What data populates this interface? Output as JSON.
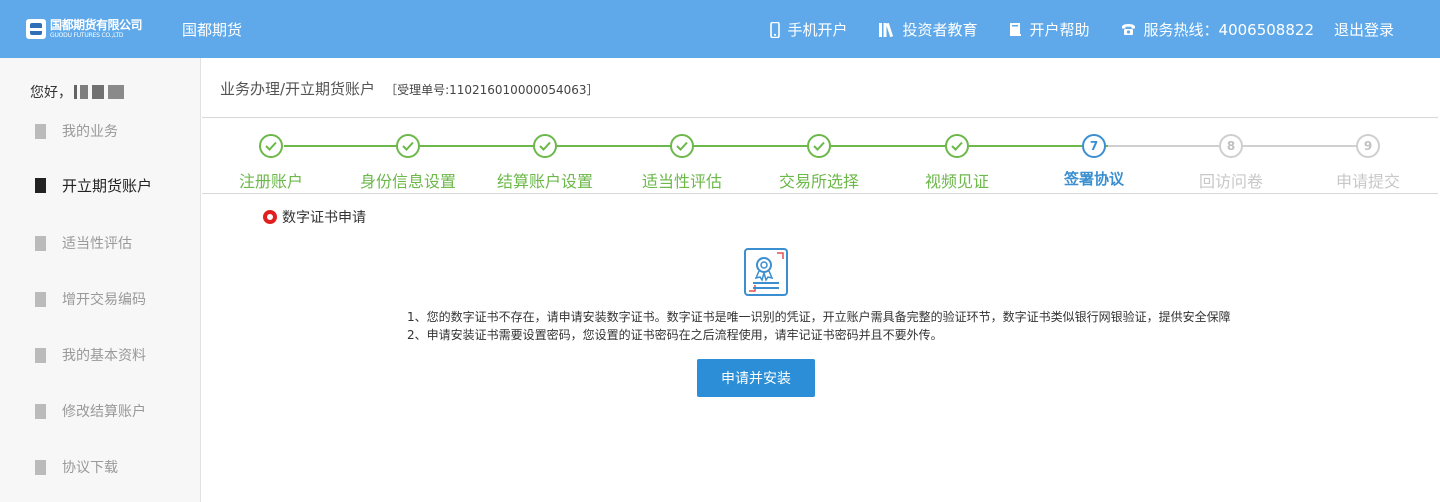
{
  "header": {
    "logo_cn": "国都期货有限公司",
    "logo_en": "GUODU FUTURES CO.,LTD",
    "brand": "国都期货",
    "nav": [
      {
        "label": "手机开户",
        "icon": "mobile-icon"
      },
      {
        "label": "投资者教育",
        "icon": "books-icon"
      },
      {
        "label": "开户帮助",
        "icon": "help-book-icon"
      },
      {
        "label": "服务热线：4006508822",
        "icon": "phone-icon"
      }
    ],
    "logout": "退出登录"
  },
  "sidebar": {
    "greeting": "您好，",
    "items": [
      {
        "label": "我的业务",
        "active": false
      },
      {
        "label": "开立期货账户",
        "active": true
      },
      {
        "label": "适当性评估",
        "active": false
      },
      {
        "label": "增开交易编码",
        "active": false
      },
      {
        "label": "我的基本资料",
        "active": false
      },
      {
        "label": "修改结算账户",
        "active": false
      },
      {
        "label": "协议下载",
        "active": false
      }
    ]
  },
  "breadcrumb": {
    "path": "业务办理/开立期货账户",
    "ticket": "［受理单号:110216010000054063］"
  },
  "steps": [
    {
      "label": "注册账户",
      "status": "done"
    },
    {
      "label": "身份信息设置",
      "status": "done"
    },
    {
      "label": "结算账户设置",
      "status": "done"
    },
    {
      "label": "适当性评估",
      "status": "done"
    },
    {
      "label": "交易所选择",
      "status": "done"
    },
    {
      "label": "视频见证",
      "status": "done"
    },
    {
      "label": "签署协议",
      "status": "current",
      "number": "7"
    },
    {
      "label": "回访问卷",
      "status": "pending",
      "number": "8"
    },
    {
      "label": "申请提交",
      "status": "pending",
      "number": "9"
    }
  ],
  "section": {
    "title": "数字证书申请",
    "note1": "1、您的数字证书不存在，请申请安装数字证书。数字证书是唯一识别的凭证，开立账户需具备完整的验证环节，数字证书类似银行网银验证，提供安全保障",
    "note2": "2、申请安装证书需要设置密码，您设置的证书密码在之后流程使用，请牢记证书密码并且不要外传。",
    "button": "申请并安装"
  },
  "colors": {
    "header_bg": "#5fa9ea",
    "done_green": "#6cb84a",
    "current_blue": "#3b8fd0",
    "button_blue": "#2b8ed6",
    "radio_red": "#e02020"
  }
}
